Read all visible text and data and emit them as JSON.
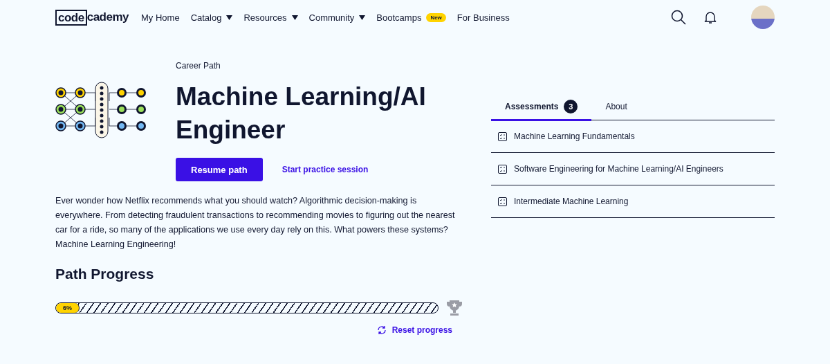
{
  "nav": {
    "logo": {
      "boxed": "code",
      "rest": "cademy"
    },
    "items": [
      {
        "label": "My Home",
        "dropdown": false
      },
      {
        "label": "Catalog",
        "dropdown": true
      },
      {
        "label": "Resources",
        "dropdown": true
      },
      {
        "label": "Community",
        "dropdown": true
      },
      {
        "label": "Bootcamps",
        "dropdown": false,
        "badge": "New"
      },
      {
        "label": "For Business",
        "dropdown": false
      }
    ]
  },
  "hero": {
    "eyebrow": "Career Path",
    "title": "Machine Learning/AI Engineer",
    "primary_button": "Resume path",
    "secondary_link": "Start practice session"
  },
  "description": "Ever wonder how Netflix recommends what you should watch? Algorithmic decision-making is everywhere. From detecting fraudulent transactions to recommending movies to figuring out the nearest car for a ride, so many of the applications we use every day rely on this. What powers these systems? Machine Learning Engineering!",
  "progress": {
    "heading": "Path Progress",
    "level": 0.06,
    "reading": "6%",
    "reset": "Reset progress"
  },
  "tabs": [
    {
      "label": "Assessments",
      "count": "3",
      "selected": true
    },
    {
      "label": "About",
      "selected": false
    }
  ],
  "assessments": [
    "Machine Learning Fundamentals",
    "Software Engineering for Machine Learning/AI Engineers",
    "Intermediate Machine Learning"
  ]
}
